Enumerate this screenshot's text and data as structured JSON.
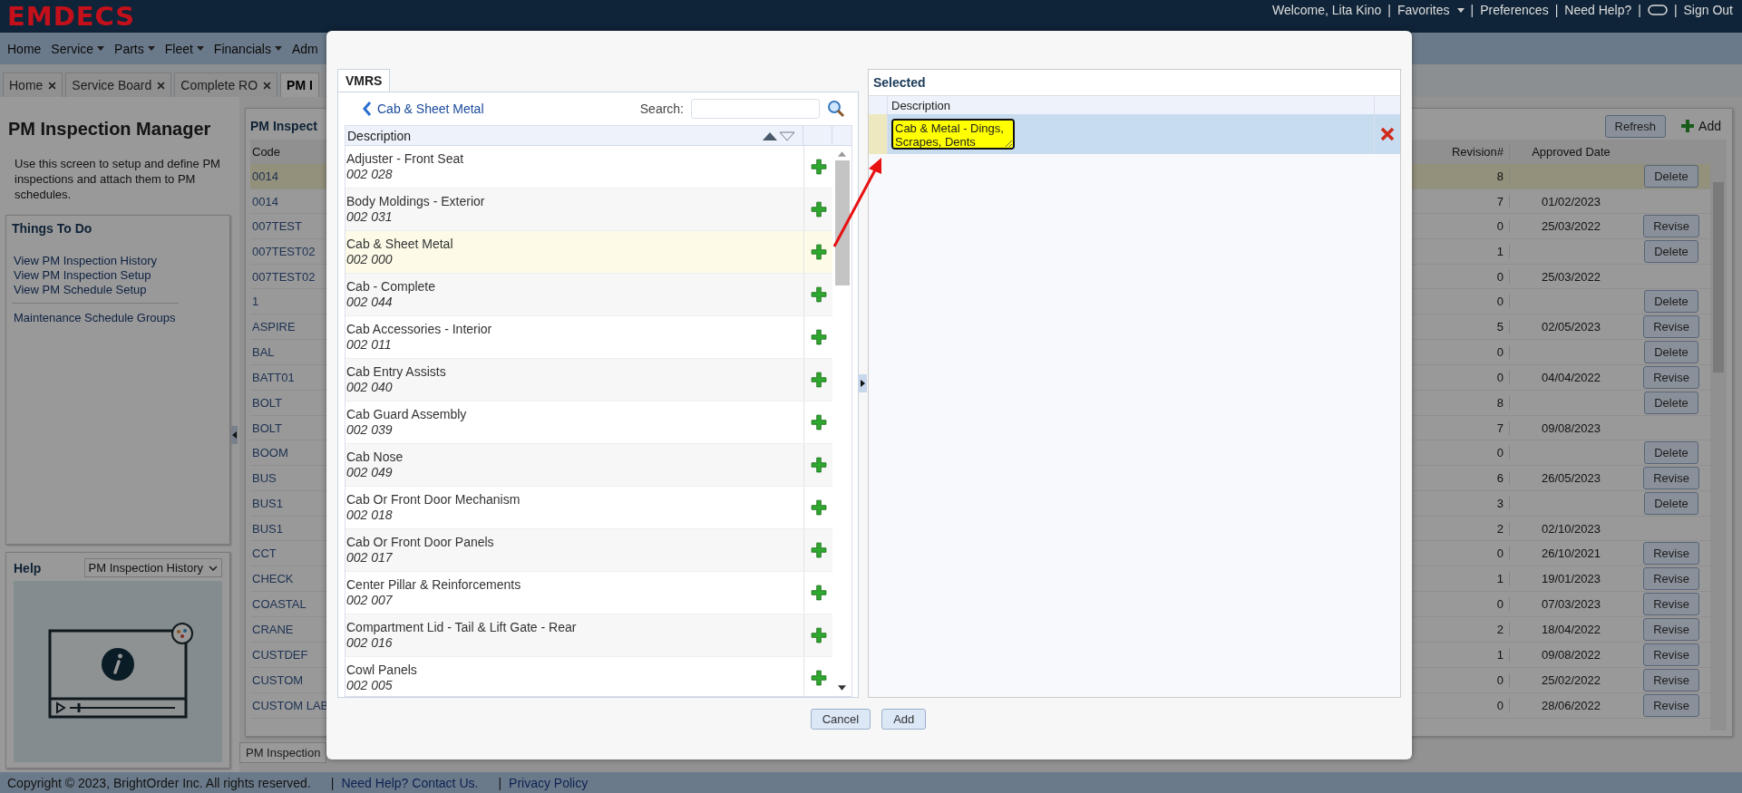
{
  "header": {
    "logo": "EMDECS",
    "links": [
      {
        "kind": "text",
        "label": "Welcome, Lita Kino"
      },
      {
        "kind": "sep",
        "label": "|"
      },
      {
        "kind": "menu",
        "label": "Favorites"
      },
      {
        "kind": "sep",
        "label": "|"
      },
      {
        "kind": "link",
        "label": "Preferences"
      },
      {
        "kind": "sep",
        "label": "|"
      },
      {
        "kind": "link",
        "label": "Need Help?"
      },
      {
        "kind": "sep",
        "label": "|"
      },
      {
        "kind": "icon"
      },
      {
        "kind": "sep",
        "label": "|"
      },
      {
        "kind": "link",
        "label": "Sign Out"
      }
    ]
  },
  "menu": [
    {
      "label": "Home",
      "dropdown": false
    },
    {
      "label": "Service",
      "dropdown": true
    },
    {
      "label": "Parts",
      "dropdown": true
    },
    {
      "label": "Fleet",
      "dropdown": true
    },
    {
      "label": "Financials",
      "dropdown": true
    },
    {
      "label": "Adm",
      "dropdown": false
    }
  ],
  "tabs": [
    {
      "label": "Home",
      "selected": false,
      "closable": true
    },
    {
      "label": "Service Board",
      "selected": false,
      "closable": true
    },
    {
      "label": "Complete RO",
      "selected": false,
      "closable": true
    },
    {
      "label": "PM I",
      "selected": true,
      "closable": false
    }
  ],
  "sidebar": {
    "title": "PM Inspection Manager",
    "intro": "Use this screen to setup and define PM inspections and attach them to PM schedules.",
    "things_to_do": {
      "title": "Things To Do",
      "groups": [
        {
          "links": [
            "View PM Inspection History",
            "View PM Inspection Setup",
            "View PM Schedule Setup"
          ]
        },
        {
          "links": [
            "Maintenance Schedule Groups"
          ]
        }
      ]
    },
    "help": {
      "title": "Help",
      "select": "PM Inspection History"
    }
  },
  "inspections": {
    "title": "PM Inspect",
    "refresh": "Refresh",
    "add": "Add",
    "columns": [
      "Code",
      "Revision#",
      "Approved Date"
    ],
    "rows": [
      {
        "code": "0014",
        "revision": "8",
        "approved": "",
        "action": "Delete",
        "selected": true
      },
      {
        "code": "0014",
        "revision": "7",
        "approved": "01/02/2023",
        "action": "",
        "selected": false
      },
      {
        "code": "007TEST",
        "revision": "0",
        "approved": "25/03/2022",
        "action": "Revise",
        "selected": false
      },
      {
        "code": "007TEST02",
        "revision": "1",
        "approved": "",
        "action": "Delete",
        "selected": false
      },
      {
        "code": "007TEST02",
        "revision": "0",
        "approved": "25/03/2022",
        "action": "",
        "selected": false
      },
      {
        "code": "1",
        "revision": "0",
        "approved": "",
        "action": "Delete",
        "selected": false
      },
      {
        "code": "ASPIRE",
        "revision": "5",
        "approved": "02/05/2023",
        "action": "Revise",
        "selected": false
      },
      {
        "code": "BAL",
        "revision": "0",
        "approved": "",
        "action": "Delete",
        "selected": false
      },
      {
        "code": "BATT01",
        "revision": "0",
        "approved": "04/04/2022",
        "action": "Revise",
        "selected": false
      },
      {
        "code": "BOLT",
        "revision": "8",
        "approved": "",
        "action": "Delete",
        "selected": false
      },
      {
        "code": "BOLT",
        "revision": "7",
        "approved": "09/08/2023",
        "action": "",
        "selected": false
      },
      {
        "code": "BOOM",
        "revision": "0",
        "approved": "",
        "action": "Delete",
        "selected": false
      },
      {
        "code": "BUS",
        "revision": "6",
        "approved": "26/05/2023",
        "action": "Revise",
        "selected": false
      },
      {
        "code": "BUS1",
        "revision": "3",
        "approved": "",
        "action": "Delete",
        "selected": false
      },
      {
        "code": "BUS1",
        "revision": "2",
        "approved": "02/10/2023",
        "action": "",
        "selected": false
      },
      {
        "code": "CCT",
        "revision": "0",
        "approved": "26/10/2021",
        "action": "Revise",
        "selected": false
      },
      {
        "code": "CHECK",
        "revision": "1",
        "approved": "19/01/2023",
        "action": "Revise",
        "selected": false
      },
      {
        "code": "COASTAL",
        "revision": "0",
        "approved": "07/03/2023",
        "action": "Revise",
        "selected": false
      },
      {
        "code": "CRANE",
        "revision": "2",
        "approved": "18/04/2022",
        "action": "Revise",
        "selected": false
      },
      {
        "code": "CUSTDEF",
        "revision": "1",
        "approved": "09/08/2022",
        "action": "Revise",
        "selected": false
      },
      {
        "code": "CUSTOM",
        "revision": "0",
        "approved": "25/02/2022",
        "action": "Revise",
        "selected": false
      },
      {
        "code": "CUSTOM LAB",
        "revision": "0",
        "approved": "28/06/2022",
        "action": "Revise",
        "selected": false
      }
    ],
    "bottom_tab": "PM Inspection"
  },
  "dialog": {
    "vmrs": {
      "tab": "VMRS",
      "breadcrumb": "Cab & Sheet Metal",
      "search_label": "Search:",
      "column": "Description",
      "items": [
        {
          "name": "Adjuster - Front Seat",
          "code": "002 028",
          "selected": false
        },
        {
          "name": "Body Moldings - Exterior",
          "code": "002 031",
          "selected": false
        },
        {
          "name": "Cab & Sheet Metal",
          "code": "002 000",
          "selected": true
        },
        {
          "name": "Cab - Complete",
          "code": "002 044",
          "selected": false
        },
        {
          "name": "Cab Accessories - Interior",
          "code": "002 011",
          "selected": false
        },
        {
          "name": "Cab Entry Assists",
          "code": "002 040",
          "selected": false
        },
        {
          "name": "Cab Guard Assembly",
          "code": "002 039",
          "selected": false
        },
        {
          "name": "Cab Nose",
          "code": "002 049",
          "selected": false
        },
        {
          "name": "Cab Or Front Door Mechanism",
          "code": "002 018",
          "selected": false
        },
        {
          "name": "Cab Or Front Door Panels",
          "code": "002 017",
          "selected": false
        },
        {
          "name": "Center Pillar & Reinforcements",
          "code": "002 007",
          "selected": false
        },
        {
          "name": "Compartment Lid - Tail & Lift Gate - Rear",
          "code": "002 016",
          "selected": false
        },
        {
          "name": "Cowl Panels",
          "code": "002 005",
          "selected": false
        }
      ]
    },
    "selected": {
      "title": "Selected",
      "column": "Description",
      "rows": [
        {
          "value": "Cab & Metal - Dings, Scrapes, Dents"
        }
      ]
    },
    "buttons": [
      "Cancel",
      "Add"
    ]
  },
  "footer": {
    "copyright": "Copyright © 2023, BrightOrder Inc. All rights reserved.",
    "links": [
      {
        "sep": "|",
        "label": "Need Help? Contact Us."
      },
      {
        "sep": "|",
        "label": "Privacy Policy"
      }
    ]
  }
}
